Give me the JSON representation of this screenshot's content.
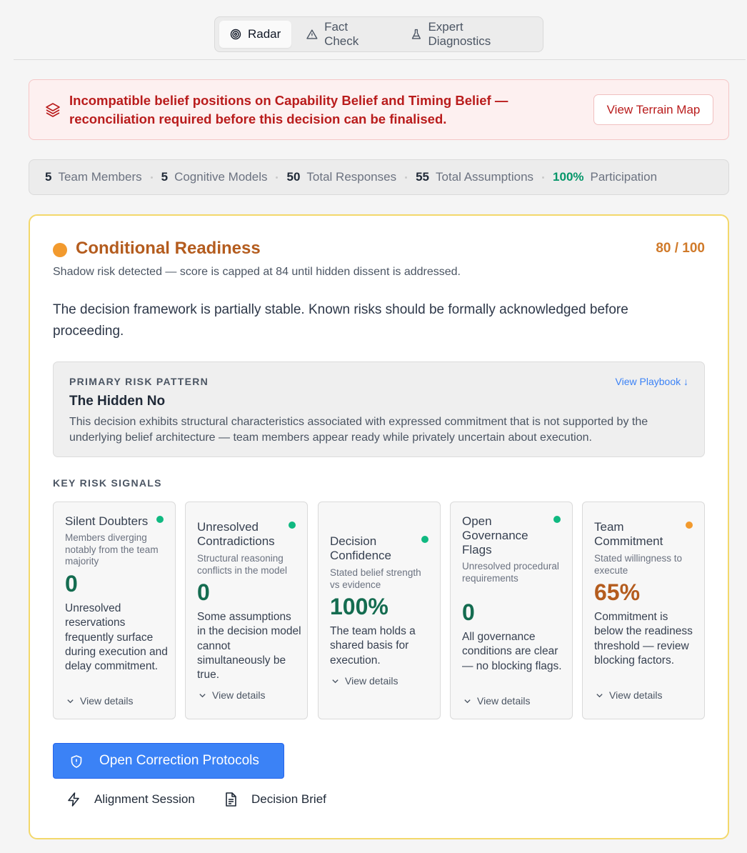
{
  "tabs": [
    {
      "label": "Radar",
      "icon": "radar-icon",
      "active": true
    },
    {
      "label": "Fact Check",
      "icon": "warning-triangle-icon",
      "active": false
    },
    {
      "label": "Expert Diagnostics",
      "icon": "flask-icon",
      "active": false
    }
  ],
  "alert": {
    "message": "Incompatible belief positions on Capability Belief and Timing Belief — reconciliation required before this decision can be finalised.",
    "button": "View Terrain Map",
    "icon": "layers-icon",
    "color": "#b91c1c"
  },
  "stats": [
    {
      "value": "5",
      "label": "Team Members"
    },
    {
      "value": "5",
      "label": "Cognitive Models"
    },
    {
      "value": "50",
      "label": "Total Responses"
    },
    {
      "value": "55",
      "label": "Total Assumptions"
    },
    {
      "value": "100%",
      "label": "Participation"
    }
  ],
  "readiness": {
    "title": "Conditional Readiness",
    "score": "80 / 100",
    "note": "Shadow risk detected — score is capped at 84 until hidden dissent is addressed.",
    "summary": "The decision framework is partially stable. Known risks should be formally acknowledged before proceeding.",
    "accent": "#b45c1e"
  },
  "risk_pattern": {
    "label": "PRIMARY RISK PATTERN",
    "playbook": "View Playbook ↓",
    "name": "The Hidden No",
    "description": "This decision exhibits structural characteristics associated with expressed commitment that is not supported by the underlying belief architecture — team members appear ready while privately uncertain about execution."
  },
  "signals_label": "KEY RISK SIGNALS",
  "signals": [
    {
      "title": "Silent Doubters",
      "subtitle": "Members diverging notably from the team majority",
      "value": "0",
      "status": "green",
      "description": "Unresolved reservations frequently surface during execution and delay commitment.",
      "link": "View details"
    },
    {
      "title": "Unresolved Contradictions",
      "subtitle": "Structural reasoning conflicts in the model",
      "value": "0",
      "status": "green",
      "description": "Some assumptions in the decision model cannot simultaneously be true.",
      "link": "View details"
    },
    {
      "title": "Decision Confidence",
      "subtitle": "Stated belief strength vs evidence",
      "value": "100%",
      "status": "green",
      "description": "The team holds a shared basis for execution.",
      "link": "View details"
    },
    {
      "title": "Open Governance Flags",
      "subtitle": "Unresolved procedural requirements",
      "value": "0",
      "status": "green",
      "description": "All governance conditions are clear — no blocking flags.",
      "link": "View details"
    },
    {
      "title": "Team Commitment",
      "subtitle": "Stated willingness to execute",
      "value": "65%",
      "status": "orange",
      "description": "Commitment is below the readiness threshold — review blocking factors.",
      "link": "View details"
    }
  ],
  "actions": {
    "primary": "Open Correction Protocols",
    "alignment": "Alignment Session",
    "brief": "Decision Brief"
  }
}
